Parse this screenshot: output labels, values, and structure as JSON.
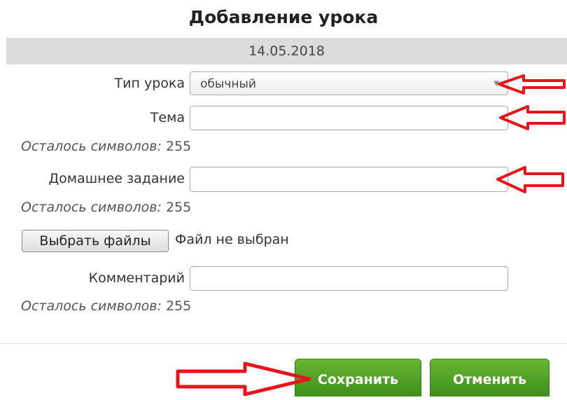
{
  "page": {
    "title": "Добавление урока",
    "date": "14.05.2018"
  },
  "form": {
    "lesson_type": {
      "label": "Тип урока",
      "value": "обычный"
    },
    "topic": {
      "label": "Тема",
      "value": ""
    },
    "homework": {
      "label": "Домашнее задание",
      "value": ""
    },
    "comment": {
      "label": "Комментарий",
      "value": ""
    },
    "remaining": {
      "label": "Осталось символов:",
      "count": "255"
    },
    "file": {
      "button_label": "Выбрать файлы",
      "status": "Файл не выбран"
    }
  },
  "actions": {
    "save_label": "Сохранить",
    "cancel_label": "Отменить"
  },
  "colors": {
    "accent_green": "#4c9a23",
    "annotation_red": "#e8141b",
    "band_gray": "#dcdcdc"
  },
  "annotations": {
    "arrow_count": 4,
    "icon": "red-outline-arrow-icon"
  }
}
